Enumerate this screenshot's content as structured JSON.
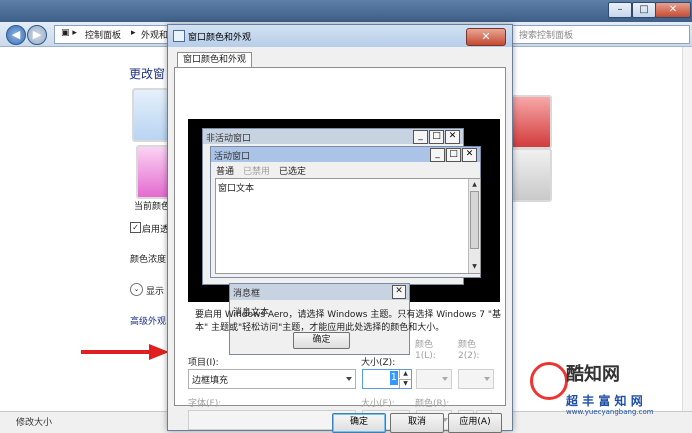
{
  "background_window": {
    "address_parts": [
      "控制面板",
      "外观和"
    ],
    "search_placeholder": "搜索控制面板",
    "page_title": "更改窗",
    "labels": {
      "current_color": "当前颜色",
      "enable_transparency": "启用透",
      "color_intensity": "颜色浓度",
      "show_mixer": "显示",
      "advanced_settings": "高级外观"
    },
    "status_text": "修改大小",
    "swatch_colors": [
      "#4a88d8",
      "#c42b2b",
      "#e46bd0",
      "#7a7a7a"
    ]
  },
  "dialog": {
    "title": "窗口颜色和外观",
    "tab_label": "窗口颜色和外观",
    "preview": {
      "inactive_window_title": "非活动窗口",
      "active_window_title": "活动窗口",
      "menu_items": [
        "普通",
        "已禁用",
        "已选定"
      ],
      "window_text": "窗口文本",
      "message_box_title": "消息框",
      "message_text": "消息文本",
      "ok_button": "确定"
    },
    "hint": "要启用 Windows Aero，请选择 Windows 主题。只有选择 Windows 7 \"基本\" 主题或\"轻松访问\"主题，才能应用此处选择的颜色和大小。",
    "labels": {
      "item": "项目(I):",
      "size": "大小(Z):",
      "color1": "颜色 1(L):",
      "color2": "颜色 2(2):",
      "font": "字体(F):",
      "font_size": "大小(E):",
      "font_color": "颜色(R):"
    },
    "item_value": "边框填充",
    "size_value": "1",
    "buttons": {
      "ok": "确定",
      "cancel": "取消",
      "apply": "应用(A)"
    }
  },
  "watermark": {
    "line1": "酷知网",
    "line2": "超 丰 富 知 网",
    "line3": "www.yuecyangbang.com"
  },
  "colors": {
    "arrow": "#e02020",
    "link": "#1e3287",
    "active_title": "#aac3e6",
    "inactive_title": "#c8d3e2"
  }
}
